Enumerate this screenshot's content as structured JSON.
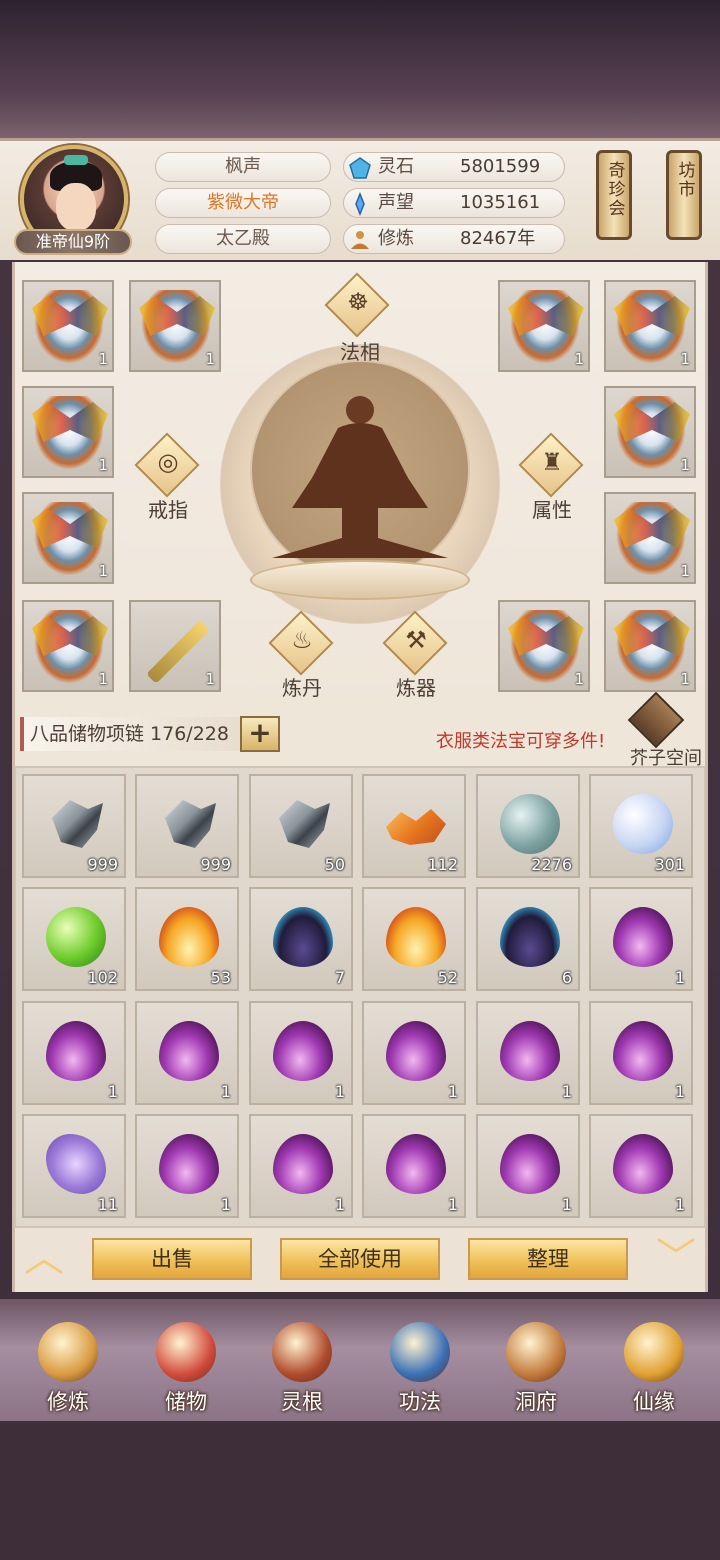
{
  "player": {
    "name": "枫声",
    "title": "紫微大帝",
    "sect": "太乙殿",
    "realm": "准帝仙9阶"
  },
  "stats": [
    {
      "label": "灵石",
      "value": "5801599",
      "icon": "spirit-stone-icon"
    },
    {
      "label": "声望",
      "value": "1035161",
      "icon": "prestige-icon"
    },
    {
      "label": "修炼",
      "value": "82467年",
      "icon": "cultivation-icon"
    }
  ],
  "top_buttons": {
    "treasure": "奇珍会",
    "market": "坊市"
  },
  "equip": {
    "faxiang": "法相",
    "ring": "戒指",
    "attr": "属性",
    "alchemy": "炼丹",
    "forge": "炼器",
    "slot_counts": [
      "1",
      "1",
      "1",
      "1",
      "1",
      "1",
      "1",
      "1",
      "1",
      "1",
      "1",
      "1"
    ]
  },
  "bag": {
    "label": "八品储物项链 176/228",
    "plus": "+",
    "notice": "衣服类法宝可穿多件!",
    "mustard_space": "芥子空间"
  },
  "inventory": [
    {
      "kind": "ore",
      "count": "999"
    },
    {
      "kind": "ore",
      "count": "999"
    },
    {
      "kind": "ore",
      "count": "50"
    },
    {
      "kind": "shard",
      "count": "112"
    },
    {
      "kind": "pearl-teal",
      "count": "2276"
    },
    {
      "kind": "pearl-white",
      "count": "301"
    },
    {
      "kind": "pearl-green",
      "count": "102"
    },
    {
      "kind": "flame-orange",
      "count": "53"
    },
    {
      "kind": "flame-dark",
      "count": "7"
    },
    {
      "kind": "flame-orange",
      "count": "52"
    },
    {
      "kind": "flame-dark",
      "count": "6"
    },
    {
      "kind": "flame-purple",
      "count": "1"
    },
    {
      "kind": "flame-purple",
      "count": "1"
    },
    {
      "kind": "flame-purple",
      "count": "1"
    },
    {
      "kind": "flame-purple",
      "count": "1"
    },
    {
      "kind": "flame-purple",
      "count": "1"
    },
    {
      "kind": "flame-purple",
      "count": "1"
    },
    {
      "kind": "flame-purple",
      "count": "1"
    },
    {
      "kind": "cloud-purple",
      "count": "11"
    },
    {
      "kind": "flame-purple",
      "count": "1"
    },
    {
      "kind": "flame-purple",
      "count": "1"
    },
    {
      "kind": "flame-purple",
      "count": "1"
    },
    {
      "kind": "flame-purple",
      "count": "1"
    },
    {
      "kind": "flame-purple",
      "count": "1"
    }
  ],
  "actions": {
    "sell": "出售",
    "use_all": "全部使用",
    "sort": "整理"
  },
  "nav": [
    {
      "label": "修炼",
      "icon": "cultivation-nav-icon",
      "color": "#d99a3f"
    },
    {
      "label": "储物",
      "icon": "storage-bag-icon",
      "color": "#d24a3c"
    },
    {
      "label": "灵根",
      "icon": "spirit-root-icon",
      "color": "#b04a2c"
    },
    {
      "label": "功法",
      "icon": "technique-book-icon",
      "color": "#3a6fb5"
    },
    {
      "label": "洞府",
      "icon": "cave-dwelling-icon",
      "color": "#c27a3b"
    },
    {
      "label": "仙缘",
      "icon": "immortal-fate-icon",
      "color": "#e0a030"
    }
  ]
}
